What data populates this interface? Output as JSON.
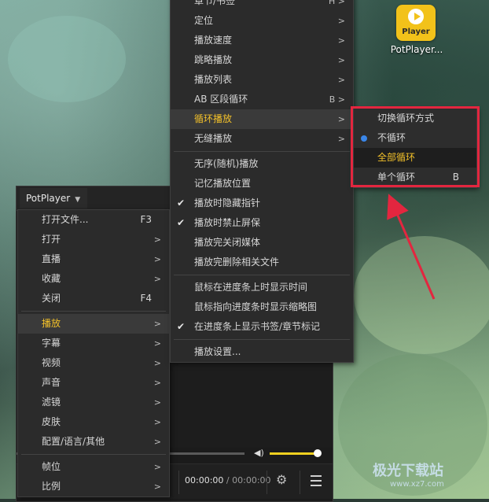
{
  "desktop": {
    "app_icon_text": "Player",
    "app_label": "PotPlayer..."
  },
  "player": {
    "logo_label": "PotPlayer",
    "time_current": "00:00:00",
    "time_sep": "/",
    "time_total": "00:00:00",
    "volume_level": 0.95
  },
  "main_menu": {
    "items": [
      {
        "label": "打开文件...",
        "shortcut": "F3"
      },
      {
        "label": "打开",
        "submenu": ">"
      },
      {
        "label": "直播",
        "submenu": ">"
      },
      {
        "label": "收藏",
        "submenu": ">"
      },
      {
        "label": "关闭",
        "shortcut": "F4"
      },
      {
        "label": "播放",
        "submenu": ">",
        "active": true
      },
      {
        "label": "字幕",
        "submenu": ">"
      },
      {
        "label": "视频",
        "submenu": ">"
      },
      {
        "label": "声音",
        "submenu": ">"
      },
      {
        "label": "滤镜",
        "submenu": ">"
      },
      {
        "label": "皮肤",
        "submenu": ">"
      },
      {
        "label": "配置/语言/其他",
        "submenu": ">"
      },
      {
        "label": "帧位",
        "submenu": ">"
      },
      {
        "label": "比例",
        "submenu": ">"
      }
    ]
  },
  "play_menu": {
    "items": [
      {
        "label": "章节/书签",
        "submenu": "H >"
      },
      {
        "label": "定位",
        "submenu": ">"
      },
      {
        "label": "播放速度",
        "submenu": ">"
      },
      {
        "label": "跳略播放",
        "submenu": ">"
      },
      {
        "label": "播放列表",
        "submenu": ">"
      },
      {
        "label": "AB 区段循环",
        "submenu": "B >"
      },
      {
        "label": "循环播放",
        "submenu": ">",
        "active": true
      },
      {
        "label": "无缝播放",
        "submenu": ">"
      },
      {
        "label": "无序(随机)播放"
      },
      {
        "label": "记忆播放位置"
      },
      {
        "label": "播放时隐藏指针",
        "checked": "✔"
      },
      {
        "label": "播放时禁止屏保",
        "checked": "✔"
      },
      {
        "label": "播放完关闭媒体"
      },
      {
        "label": "播放完删除相关文件"
      },
      {
        "label": "鼠标在进度条上时显示时间"
      },
      {
        "label": "鼠标指向进度条时显示缩略图"
      },
      {
        "label": "在进度条上显示书签/章节标记",
        "checked": "✔"
      },
      {
        "label": "播放设置..."
      }
    ]
  },
  "loop_menu": {
    "items": [
      {
        "label": "切换循环方式"
      },
      {
        "label": "不循环",
        "selected": true
      },
      {
        "label": "全部循环",
        "active": true
      },
      {
        "label": "单个循环",
        "shortcut": "B"
      }
    ]
  },
  "colors": {
    "accent": "#f3c12a",
    "highlight_box": "#e3263f",
    "radio_dot": "#3a86e8",
    "volume_fill": "#f0d020"
  },
  "watermark": {
    "title": "极光下载站",
    "url": "www.xz7.com"
  }
}
